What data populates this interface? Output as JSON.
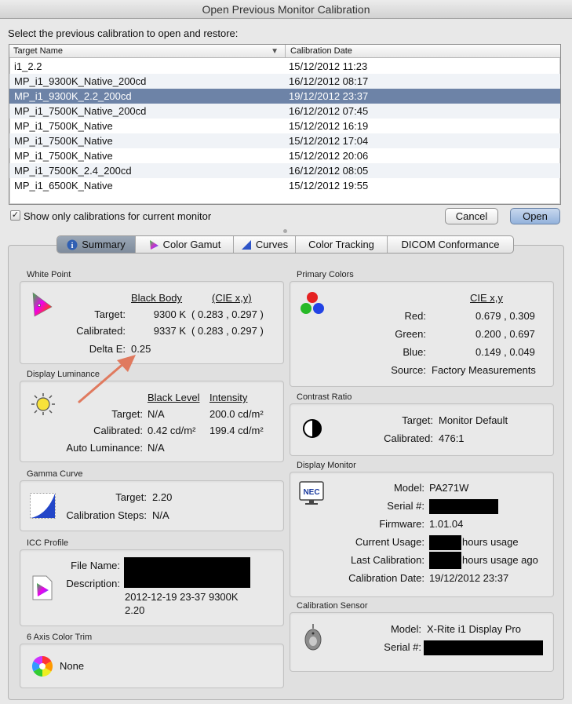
{
  "window": {
    "title": "Open Previous Monitor Calibration"
  },
  "prompt": "Select the previous calibration to open and restore:",
  "list": {
    "columns": [
      "Target Name",
      "Calibration Date"
    ],
    "rows": [
      {
        "name": "i1_2.2",
        "date": "15/12/2012 11:23"
      },
      {
        "name": "MP_i1_9300K_Native_200cd",
        "date": "16/12/2012 08:17"
      },
      {
        "name": "MP_i1_9300K_2.2_200cd",
        "date": "19/12/2012 23:37"
      },
      {
        "name": "MP_i1_7500K_Native_200cd",
        "date": "16/12/2012 07:45"
      },
      {
        "name": "MP_i1_7500K_Native",
        "date": "15/12/2012 16:19"
      },
      {
        "name": "MP_i1_7500K_Native",
        "date": "15/12/2012 17:04"
      },
      {
        "name": "MP_i1_7500K_Native",
        "date": "15/12/2012 20:06"
      },
      {
        "name": "MP_i1_7500K_2.4_200cd",
        "date": "16/12/2012 08:05"
      },
      {
        "name": "MP_i1_6500K_Native",
        "date": "15/12/2012 19:55"
      }
    ],
    "selected_index": 2
  },
  "show_only": {
    "label": "Show only calibrations for current monitor",
    "checked": true
  },
  "buttons": {
    "cancel": "Cancel",
    "open": "Open"
  },
  "tabs": [
    "Summary",
    "Color Gamut",
    "Curves",
    "Color Tracking",
    "DICOM Conformance"
  ],
  "white_point": {
    "section": "White Point",
    "col_black_body": "Black Body",
    "col_cie": "(CIE x,y)",
    "target_label": "Target:",
    "target_k": "9300 K",
    "target_xy": "( 0.283 , 0.297 )",
    "calibrated_label": "Calibrated:",
    "calibrated_k": "9337 K",
    "calibrated_xy": "( 0.283 , 0.297 )",
    "delta_label": "Delta E:",
    "delta_value": "0.25"
  },
  "luminance": {
    "section": "Display Luminance",
    "col_black": "Black Level",
    "col_intensity": "Intensity",
    "target_label": "Target:",
    "target_black": "N/A",
    "target_intensity": "200.0 cd/m²",
    "calibrated_label": "Calibrated:",
    "calibrated_black": "0.42 cd/m²",
    "calibrated_intensity": "199.4 cd/m²",
    "auto_label": "Auto Luminance:",
    "auto_value": "N/A"
  },
  "gamma": {
    "section": "Gamma Curve",
    "target_label": "Target:",
    "target_value": "2.20",
    "steps_label": "Calibration Steps:",
    "steps_value": "N/A"
  },
  "icc": {
    "section": "ICC Profile",
    "file_label": "File Name:",
    "desc_label": "Description:",
    "desc_line1": "2012-12-19 23-37 9300K",
    "desc_line2": "2.20"
  },
  "six_axis": {
    "section": "6 Axis Color Trim",
    "value": "None"
  },
  "primary": {
    "section": "Primary Colors",
    "col": "CIE x,y",
    "red_label": "Red:",
    "red": "0.679 , 0.309",
    "green_label": "Green:",
    "green": "0.200 , 0.697",
    "blue_label": "Blue:",
    "blue": "0.149 , 0.049",
    "source_label": "Source:",
    "source": "Factory Measurements"
  },
  "contrast": {
    "section": "Contrast Ratio",
    "target_label": "Target:",
    "target": "Monitor Default",
    "calibrated_label": "Calibrated:",
    "calibrated": "476:1"
  },
  "monitor": {
    "section": "Display Monitor",
    "logo": "NEC",
    "model_label": "Model:",
    "model": "PA271W",
    "serial_label": "Serial #:",
    "firmware_label": "Firmware:",
    "firmware": "1.01.04",
    "usage_label": "Current Usage:",
    "usage_suffix": "hours usage",
    "last_label": "Last Calibration:",
    "last_suffix": "hours usage ago",
    "date_label": "Calibration Date:",
    "date": "19/12/2012 23:37"
  },
  "sensor": {
    "section": "Calibration Sensor",
    "model_label": "Model:",
    "model": "X-Rite i1 Display Pro",
    "serial_label": "Serial #:"
  },
  "colors": {
    "selection": "#6d83a7",
    "arrow": "#e07a5f",
    "default_button": "#93b2dc"
  }
}
